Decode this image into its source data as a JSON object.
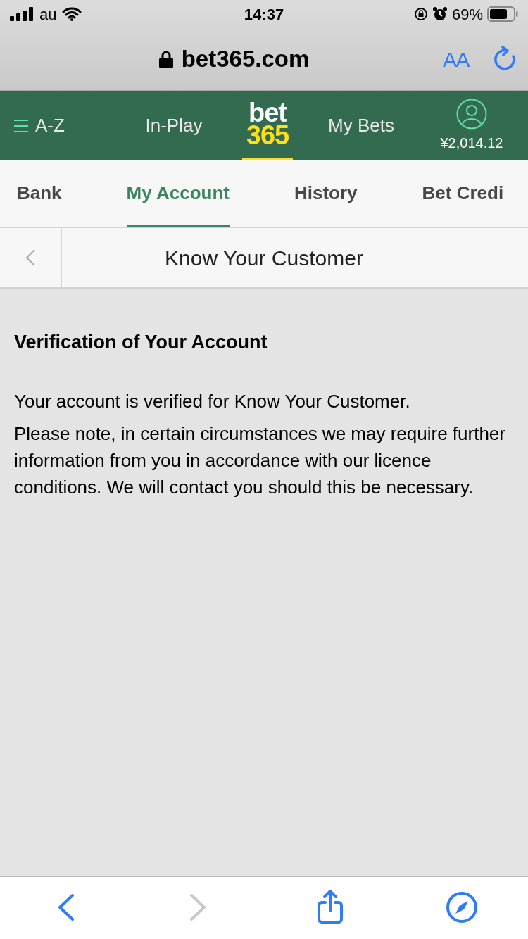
{
  "status_bar": {
    "carrier": "au",
    "time": "14:37",
    "battery": "69%"
  },
  "browser": {
    "url": "bet365.com",
    "text_size_button": "AA"
  },
  "nav": {
    "menu_label": "A-Z",
    "items": [
      {
        "label": "In-Play",
        "kind": "link"
      },
      {
        "label": "bet",
        "label_2": "365",
        "kind": "logo",
        "selected": true
      },
      {
        "label": "My Bets",
        "kind": "link"
      },
      {
        "label": "¥2,014.12",
        "kind": "account"
      }
    ]
  },
  "tabs": [
    {
      "label": "Bank",
      "selected": false
    },
    {
      "label": "My Account",
      "selected": true
    },
    {
      "label": "History",
      "selected": false
    },
    {
      "label": "Bet Credi",
      "selected": false
    }
  ],
  "page_header": {
    "title": "Know Your Customer"
  },
  "content": {
    "heading": "Verification of Your Account",
    "paragraphs": [
      "Your account is verified for Know Your Customer.",
      "Please note, in certain circumstances we may require further information from you in accordance with our licence conditions. We will contact you should this be necessary."
    ]
  },
  "toolbar": [
    {
      "kind": "back",
      "disabled": false
    },
    {
      "kind": "forward",
      "disabled": true
    },
    {
      "kind": "share",
      "disabled": false
    },
    {
      "kind": "compass",
      "disabled": false
    }
  ]
}
